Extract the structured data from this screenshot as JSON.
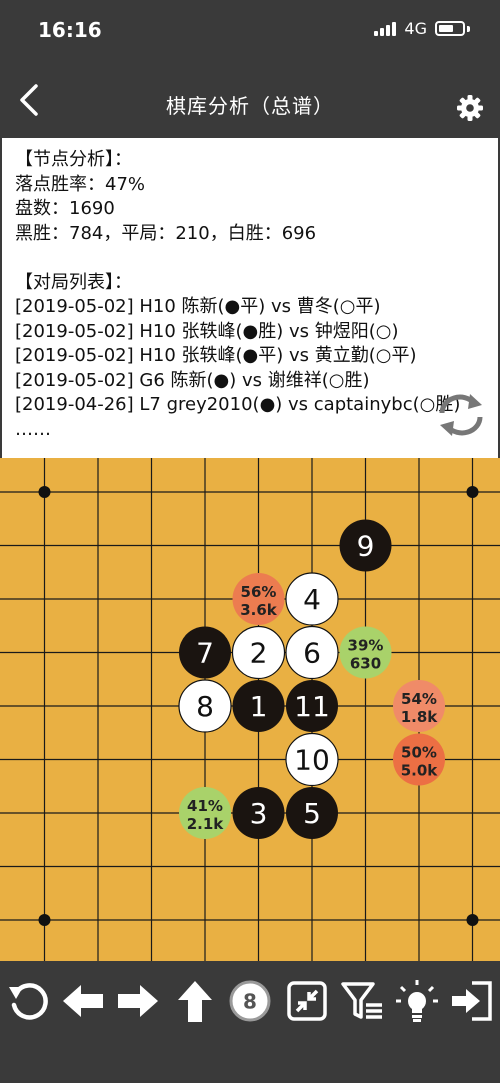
{
  "status": {
    "time": "16:16",
    "network": "4G"
  },
  "nav": {
    "title": "棋库分析（总谱）"
  },
  "info": {
    "lines": [
      "【节点分析】：",
      "落点胜率：47%",
      "盘数：1690",
      "黑胜：784，平局：210，白胜：696",
      "",
      "【对局列表】：",
      "[2019-05-02] H10 陈新(●平) vs 曹冬(○平)",
      "[2019-05-02] H10 张轶峰(●胜) vs 钟煜阳(○)",
      "[2019-05-02] H10 张轶峰(●平) vs 黄立勤(○平)",
      "[2019-05-02] G6 陈新(●) vs 谢维祥(○胜)",
      "[2019-04-26] L7 grey2010(●) vs captainybc(○胜)",
      "……"
    ]
  },
  "board": {
    "stones": [
      {
        "label": "1",
        "color": "black",
        "col": 5,
        "row": 5
      },
      {
        "label": "2",
        "color": "white",
        "col": 5,
        "row": 4
      },
      {
        "label": "3",
        "color": "black",
        "col": 5,
        "row": 7
      },
      {
        "label": "4",
        "color": "white",
        "col": 6,
        "row": 3
      },
      {
        "label": "5",
        "color": "black",
        "col": 6,
        "row": 7
      },
      {
        "label": "6",
        "color": "white",
        "col": 6,
        "row": 4
      },
      {
        "label": "7",
        "color": "black",
        "col": 4,
        "row": 4
      },
      {
        "label": "8",
        "color": "white",
        "col": 4,
        "row": 5
      },
      {
        "label": "9",
        "color": "black",
        "col": 7,
        "row": 2
      },
      {
        "label": "10",
        "color": "white",
        "col": 6,
        "row": 6
      },
      {
        "label": "11",
        "color": "black",
        "col": 6,
        "row": 5
      }
    ],
    "candidates": [
      {
        "rate": "56%",
        "count": "3.6k",
        "color": "#ec7c50",
        "col": 5,
        "row": 3
      },
      {
        "rate": "39%",
        "count": "630",
        "color": "#a9d26a",
        "col": 7,
        "row": 4
      },
      {
        "rate": "54%",
        "count": "1.8k",
        "color": "#f08b68",
        "col": 8,
        "row": 5
      },
      {
        "rate": "50%",
        "count": "5.0k",
        "color": "#ec6f44",
        "col": 8,
        "row": 6
      },
      {
        "rate": "41%",
        "count": "2.1k",
        "color": "#a9d26a",
        "col": 4,
        "row": 7
      }
    ],
    "star_points": [
      [
        1,
        1
      ],
      [
        9,
        1
      ],
      [
        1,
        9
      ],
      [
        9,
        9
      ]
    ]
  },
  "toolbar": {
    "hint_count": "8"
  },
  "colors": {
    "board": "#e9b043",
    "chrome": "#3a3a3a"
  }
}
